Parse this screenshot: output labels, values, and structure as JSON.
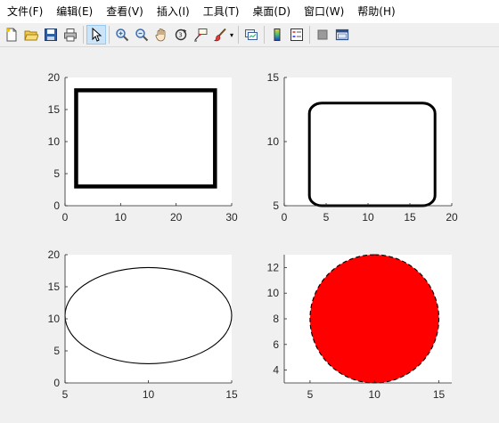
{
  "menu": [
    {
      "label": "文件(F)"
    },
    {
      "label": "编辑(E)"
    },
    {
      "label": "查看(V)"
    },
    {
      "label": "插入(I)"
    },
    {
      "label": "工具(T)"
    },
    {
      "label": "桌面(D)"
    },
    {
      "label": "窗口(W)"
    },
    {
      "label": "帮助(H)"
    }
  ],
  "toolbar": {
    "groups": [
      [
        "new-file-icon",
        "open-folder-icon",
        "save-icon",
        "print-icon"
      ],
      [
        "select-arrow-icon"
      ],
      [
        "zoom-in-icon",
        "zoom-out-icon",
        "pan-hand-icon",
        "rotate-3d-icon",
        "data-cursor-icon",
        "brush-icon"
      ],
      [
        "link-plot-icon"
      ],
      [
        "colorbar-icon",
        "legend-icon"
      ],
      [
        "hide-plot-tools-icon",
        "show-plot-tools-icon"
      ]
    ],
    "active": "select-arrow-icon"
  },
  "chart_data": [
    {
      "type": "shape",
      "shape": "rectangle",
      "position": [
        2,
        3,
        25,
        15
      ],
      "curvature": [
        0,
        0
      ],
      "line_width": "thick",
      "edge_color": "#000000",
      "face_color": "none",
      "xlim": [
        0,
        30
      ],
      "ylim": [
        0,
        20
      ],
      "xticks": [
        "0",
        "10",
        "20",
        "30"
      ],
      "yticks": [
        "0",
        "5",
        "10",
        "15",
        "20"
      ],
      "xtick_values": [
        0,
        10,
        20,
        30
      ],
      "ytick_values": [
        0,
        5,
        10,
        15,
        20
      ]
    },
    {
      "type": "shape",
      "shape": "rounded-rectangle",
      "position": [
        3,
        5,
        15,
        8
      ],
      "curvature": [
        0.2,
        0.2
      ],
      "line_width": "medium",
      "edge_color": "#000000",
      "face_color": "none",
      "xlim": [
        0,
        20
      ],
      "ylim": [
        5,
        15
      ],
      "xticks": [
        "0",
        "5",
        "10",
        "15",
        "20"
      ],
      "yticks": [
        "5",
        "10",
        "15"
      ],
      "xtick_values": [
        0,
        5,
        10,
        15,
        20
      ],
      "ytick_values": [
        5,
        10,
        15
      ]
    },
    {
      "type": "shape",
      "shape": "ellipse",
      "position": [
        5,
        3,
        10,
        15
      ],
      "curvature": [
        1,
        1
      ],
      "line_width": "thin",
      "edge_color": "#000000",
      "face_color": "none",
      "xlim": [
        5,
        15
      ],
      "ylim": [
        0,
        20
      ],
      "xticks": [
        "5",
        "10",
        "15"
      ],
      "yticks": [
        "0",
        "5",
        "10",
        "15",
        "20"
      ],
      "xtick_values": [
        5,
        10,
        15
      ],
      "ytick_values": [
        0,
        5,
        10,
        15,
        20
      ]
    },
    {
      "type": "shape",
      "shape": "circle",
      "position": [
        5,
        3,
        10,
        10
      ],
      "curvature": [
        1,
        1
      ],
      "line_width": "thin",
      "line_style": "dashed",
      "edge_color": "#000000",
      "face_color": "#ff0000",
      "xlim": [
        3,
        16
      ],
      "ylim": [
        3,
        13
      ],
      "xticks": [
        "5",
        "10",
        "15"
      ],
      "yticks": [
        "4",
        "6",
        "8",
        "10",
        "12"
      ],
      "xtick_values": [
        5,
        10,
        15
      ],
      "ytick_values": [
        4,
        6,
        8,
        10,
        12
      ]
    }
  ]
}
